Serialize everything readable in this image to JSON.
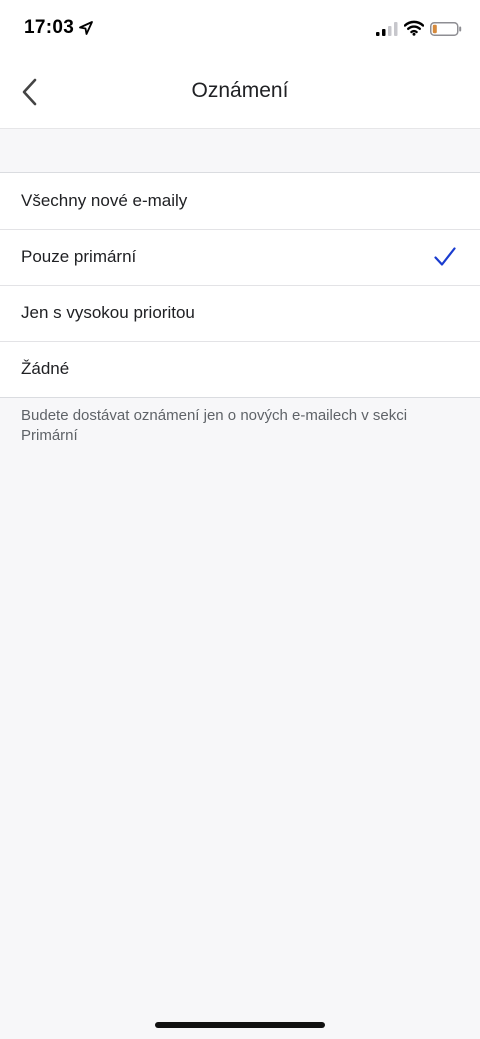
{
  "status_bar": {
    "time": "17:03"
  },
  "header": {
    "title": "Oznámení"
  },
  "options": [
    {
      "label": "Všechny nové e-maily",
      "selected": false
    },
    {
      "label": "Pouze primární",
      "selected": true
    },
    {
      "label": "Jen s vysokou prioritou",
      "selected": false
    },
    {
      "label": "Žádné",
      "selected": false
    }
  ],
  "description": "Budete dostávat oznámení jen o nových e-mailech v sekci Primární",
  "colors": {
    "accent": "#1a3ccf",
    "battery_low": "#d68a3c"
  }
}
